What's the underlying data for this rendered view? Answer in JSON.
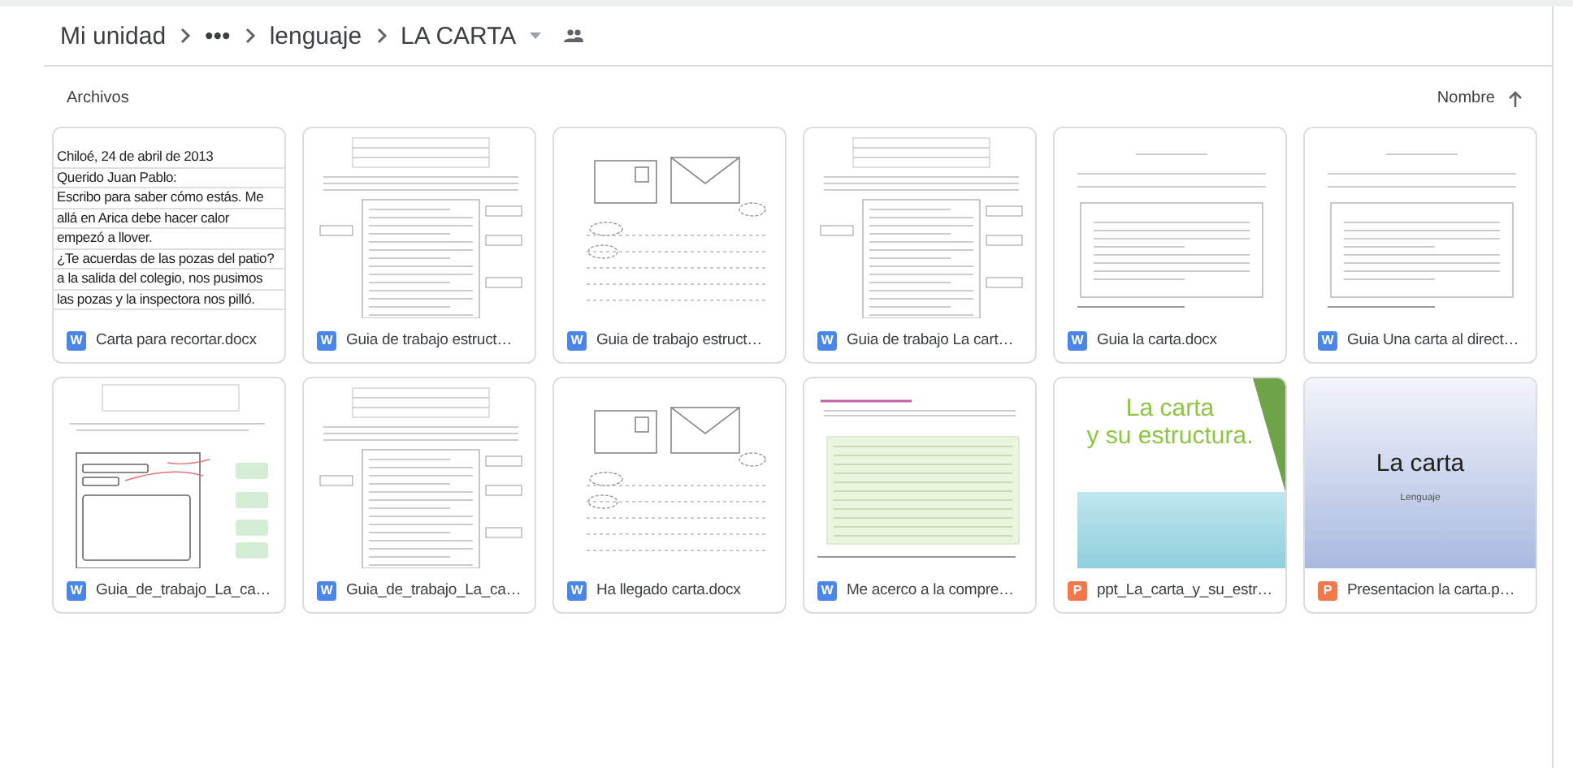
{
  "breadcrumb": [
    {
      "label": "Mi unidad"
    },
    {
      "label": "•••"
    },
    {
      "label": "lenguaje"
    },
    {
      "label": "LA CARTA"
    }
  ],
  "section_label": "Archivos",
  "sort": {
    "label": "Nombre"
  },
  "files": [
    {
      "name": "Carta para recortar.docx",
      "kind": "doc",
      "badge": "W",
      "preview": {
        "kind": "letter",
        "lines": [
          "Chiloé, 24 de abril de 2013",
          "Querido Juan Pablo:",
          "Escribo para saber cómo estás. Me",
          "allá en Arica debe hacer calor",
          "empezó a llover.",
          "¿Te acuerdas de las pozas del patio?",
          "a la salida del colegio, nos pusimos",
          "las pozas y la inspectora nos pilló."
        ]
      }
    },
    {
      "name": "Guia de trabajo estruct…",
      "kind": "doc",
      "badge": "W",
      "preview": {
        "kind": "worksheet"
      }
    },
    {
      "name": "Guia de trabajo estruct…",
      "kind": "doc",
      "badge": "W",
      "preview": {
        "kind": "envelopes"
      }
    },
    {
      "name": "Guia de trabajo La cart…",
      "kind": "doc",
      "badge": "W",
      "preview": {
        "kind": "worksheet"
      }
    },
    {
      "name": "Guia la carta.docx",
      "kind": "doc",
      "badge": "W",
      "preview": {
        "kind": "form"
      }
    },
    {
      "name": "Guia Una carta al direct…",
      "kind": "doc",
      "badge": "W",
      "preview": {
        "kind": "form"
      }
    },
    {
      "name": "Guia_de_trabajo_La_ca…",
      "kind": "doc",
      "badge": "W",
      "preview": {
        "kind": "diagram"
      }
    },
    {
      "name": "Guia_de_trabajo_La_ca…",
      "kind": "doc",
      "badge": "W",
      "preview": {
        "kind": "worksheet"
      }
    },
    {
      "name": "Ha llegado carta.docx",
      "kind": "doc",
      "badge": "W",
      "preview": {
        "kind": "envelopes"
      }
    },
    {
      "name": "Me acerco a la compre…",
      "kind": "doc",
      "badge": "W",
      "preview": {
        "kind": "reading"
      }
    },
    {
      "name": "ppt_La_carta_y_su_estr…",
      "kind": "slides",
      "badge": "P",
      "preview": {
        "kind": "slide-green",
        "title": "La carta",
        "subtitle": "y su estructura."
      }
    },
    {
      "name": "Presentacion la carta.p…",
      "kind": "slides",
      "badge": "P",
      "preview": {
        "kind": "slide-blue",
        "title": "La carta",
        "subtitle": "Lenguaje"
      }
    }
  ]
}
